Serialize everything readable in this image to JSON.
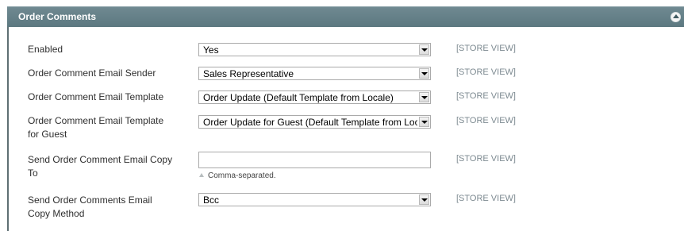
{
  "section": {
    "title": "Order Comments",
    "collapse_icon": "chevron-up-circle-icon"
  },
  "fields": {
    "enabled": {
      "label": "Enabled",
      "value": "Yes",
      "scope": "[STORE VIEW]"
    },
    "sender": {
      "label": "Order Comment Email Sender",
      "value": "Sales Representative",
      "scope": "[STORE VIEW]"
    },
    "template": {
      "label": "Order Comment Email Template",
      "value": "Order Update (Default Template from Locale)",
      "scope": "[STORE VIEW]"
    },
    "guest_template": {
      "label_line1": "Order Comment Email Template",
      "label_line2": "for Guest",
      "value": "Order Update for Guest (Default Template from Locale)",
      "scope": "[STORE VIEW]"
    },
    "copy_to": {
      "label_line1": "Send Order Comment Email Copy",
      "label_line2": "To",
      "value": "",
      "note": "Comma-separated.",
      "scope": "[STORE VIEW]"
    },
    "copy_method": {
      "label_line1": "Send Order Comments Email",
      "label_line2": "Copy Method",
      "value": "Bcc",
      "scope": "[STORE VIEW]"
    }
  }
}
